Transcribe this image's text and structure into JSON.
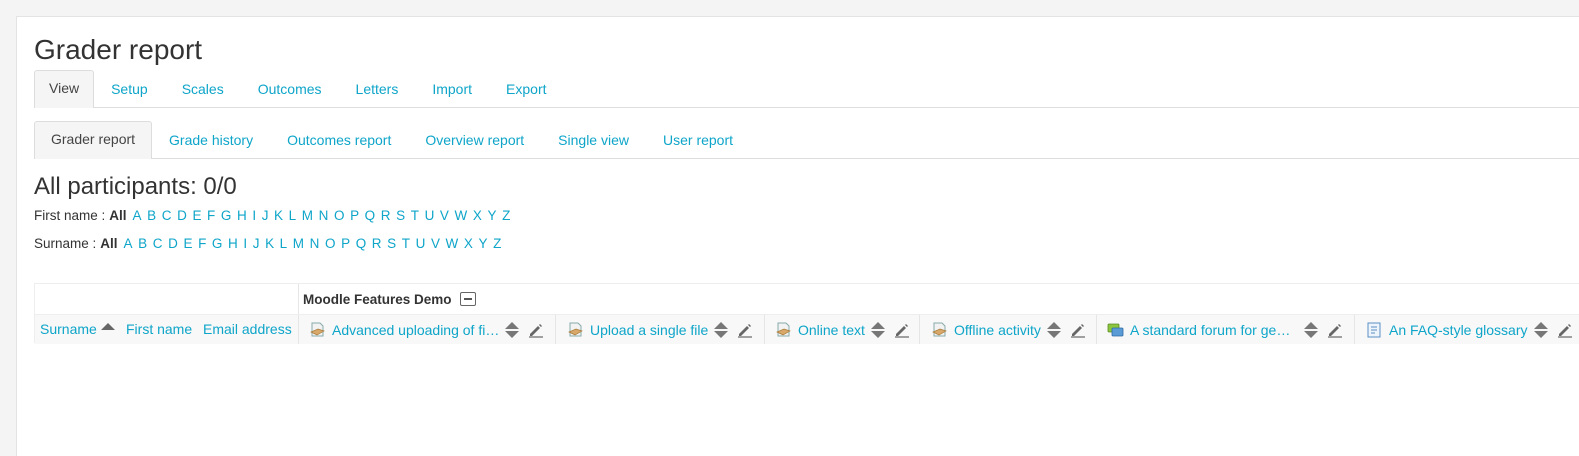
{
  "page": {
    "title": "Grader report"
  },
  "primary_tabs": [
    {
      "label": "View",
      "active": true
    },
    {
      "label": "Setup",
      "active": false
    },
    {
      "label": "Scales",
      "active": false
    },
    {
      "label": "Outcomes",
      "active": false
    },
    {
      "label": "Letters",
      "active": false
    },
    {
      "label": "Import",
      "active": false
    },
    {
      "label": "Export",
      "active": false
    }
  ],
  "secondary_tabs": [
    {
      "label": "Grader report",
      "active": true
    },
    {
      "label": "Grade history",
      "active": false
    },
    {
      "label": "Outcomes report",
      "active": false
    },
    {
      "label": "Overview report",
      "active": false
    },
    {
      "label": "Single view",
      "active": false
    },
    {
      "label": "User report",
      "active": false
    }
  ],
  "participants": {
    "heading": "All participants: 0/0"
  },
  "initials": {
    "first_label": "First name :",
    "last_label": "Surname :",
    "all_label": "All",
    "letters": [
      "A",
      "B",
      "C",
      "D",
      "E",
      "F",
      "G",
      "H",
      "I",
      "J",
      "K",
      "L",
      "M",
      "N",
      "O",
      "P",
      "Q",
      "R",
      "S",
      "T",
      "U",
      "V",
      "W",
      "X",
      "Y",
      "Z"
    ]
  },
  "table": {
    "category": "Moodle Features Demo",
    "headers": {
      "surname": "Surname",
      "firstname": "First name",
      "email": "Email address"
    },
    "items": [
      {
        "label": "Advanced uploading of fi…",
        "icon": "assignment-icon"
      },
      {
        "label": "Upload a single file",
        "icon": "assignment-icon"
      },
      {
        "label": "Online text",
        "icon": "assignment-icon"
      },
      {
        "label": "Offline activity",
        "icon": "assignment-icon"
      },
      {
        "label": "A standard forum for gen…",
        "icon": "forum-icon"
      },
      {
        "label": "An FAQ-style glossary",
        "icon": "glossary-icon"
      }
    ]
  },
  "colors": {
    "link": "#0ea5c9",
    "text": "#333333",
    "tab_active_bg": "#f5f5f5"
  }
}
